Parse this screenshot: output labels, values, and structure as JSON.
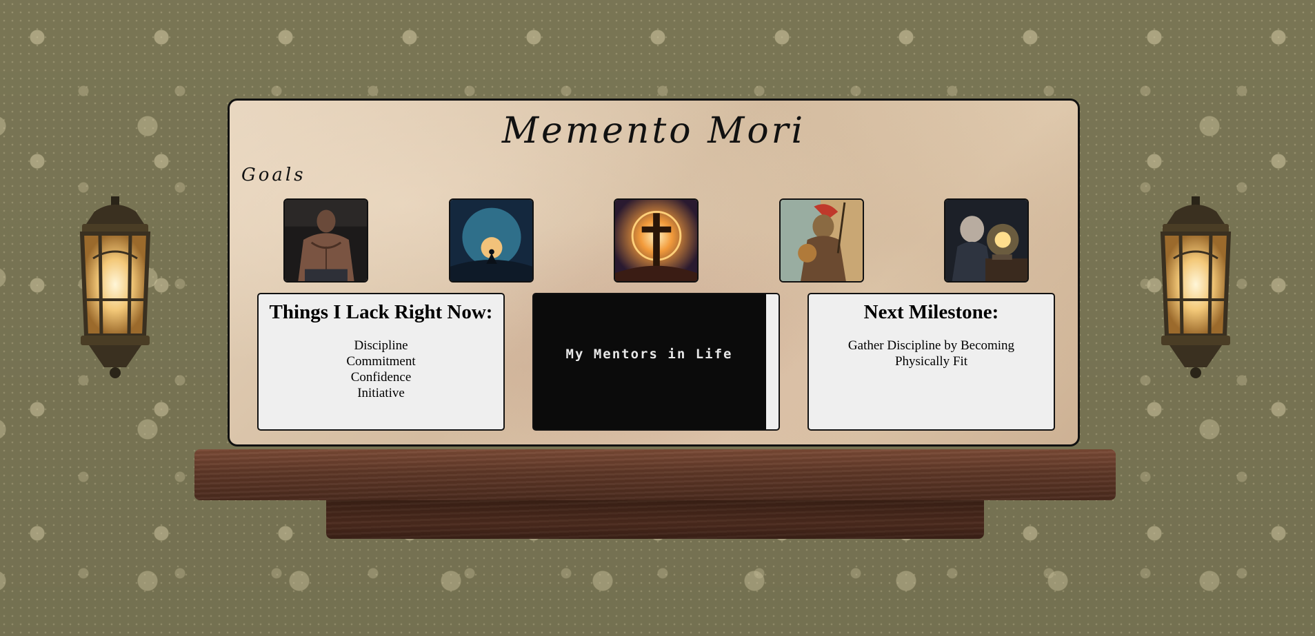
{
  "board": {
    "title": "Memento Mori",
    "goals_heading": "Goals"
  },
  "goals": [
    {
      "icon": "bodybuilder-image"
    },
    {
      "icon": "meditation-moon-image"
    },
    {
      "icon": "cross-eclipse-image"
    },
    {
      "icon": "spartan-warrior-image"
    },
    {
      "icon": "old-craftsman-image"
    }
  ],
  "lack_panel": {
    "heading": "Things I Lack Right Now:",
    "items": [
      "Discipline",
      "Commitment",
      "Confidence",
      "Initiative"
    ]
  },
  "mentors_panel": {
    "text": "My Mentors in Life"
  },
  "milestone_panel": {
    "heading": "Next Milestone:",
    "lines": [
      "Gather Discipline by Becoming",
      "Physically Fit"
    ]
  },
  "colors": {
    "wallpaper": "#7e7a58",
    "board": "#dfc9ad",
    "panel": "#efefef",
    "mentors_bg": "#0b0b0b",
    "shelf": "#5e3727"
  }
}
